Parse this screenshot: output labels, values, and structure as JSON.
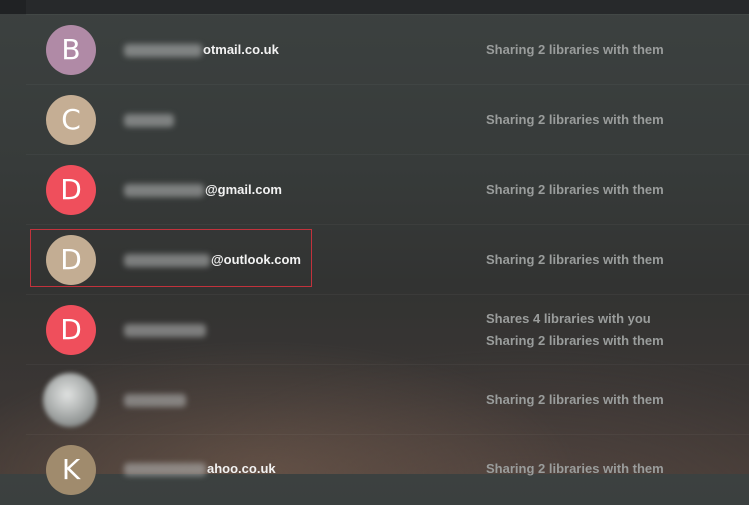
{
  "contacts": [
    {
      "initial": "B",
      "avatar_color": "#b08aa6",
      "email_visible": "otmail.co.uk",
      "status_lines": [
        "Sharing 2 libraries with them"
      ]
    },
    {
      "initial": "C",
      "avatar_color": "#c5ae94",
      "email_visible": "",
      "status_lines": [
        "Sharing 2 libraries with them"
      ]
    },
    {
      "initial": "D",
      "avatar_color": "#ef4f5c",
      "email_visible": "@gmail.com",
      "status_lines": [
        "Sharing 2 libraries with them"
      ]
    },
    {
      "initial": "D",
      "avatar_color": "#c3ad93",
      "email_visible": "@outlook.com",
      "status_lines": [
        "Sharing 2 libraries with them"
      ]
    },
    {
      "initial": "D",
      "avatar_color": "#ef4f5c",
      "email_visible": "",
      "status_lines": [
        "Shares 4 libraries with you",
        "Sharing 2 libraries with them"
      ]
    },
    {
      "initial": "",
      "avatar_color": "#9a9e9d",
      "email_visible": "",
      "status_lines": [
        "Sharing 2 libraries with them"
      ]
    },
    {
      "initial": "K",
      "avatar_color": "#a08b6d",
      "email_visible": "ahoo.co.uk",
      "status_lines": [
        "Sharing 2 libraries with them"
      ]
    }
  ]
}
